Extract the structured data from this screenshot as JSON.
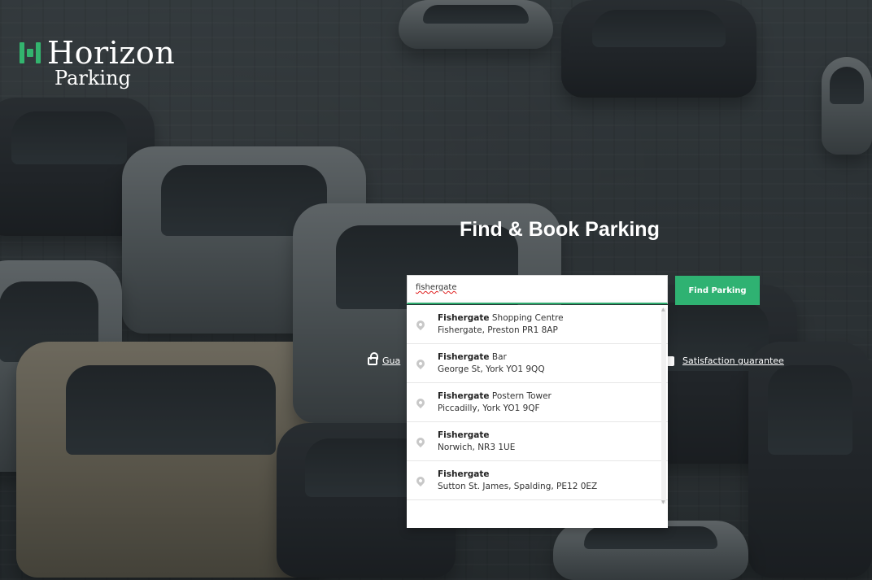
{
  "brand": {
    "name": "Horizon",
    "tagline": "Parking"
  },
  "hero": {
    "title": "Find & Book Parking"
  },
  "search": {
    "value": "fishergate",
    "button_label": "Find Parking"
  },
  "guarantees": {
    "left_label": "Gua",
    "right_label": "Satisfaction guarantee"
  },
  "suggestions": [
    {
      "bold": "Fishergate",
      "rest": " Shopping Centre",
      "address": "Fishergate, Preston PR1 8AP"
    },
    {
      "bold": "Fishergate",
      "rest": " Bar",
      "address": "George St, York YO1 9QQ"
    },
    {
      "bold": "Fishergate",
      "rest": " Postern Tower",
      "address": "Piccadilly, York YO1 9QF"
    },
    {
      "bold": "Fishergate",
      "rest": "",
      "address": "Norwich, NR3 1UE"
    },
    {
      "bold": "Fishergate",
      "rest": "",
      "address": "Sutton St. James, Spalding, PE12 0EZ"
    }
  ],
  "colors": {
    "accent": "#2fb272"
  }
}
